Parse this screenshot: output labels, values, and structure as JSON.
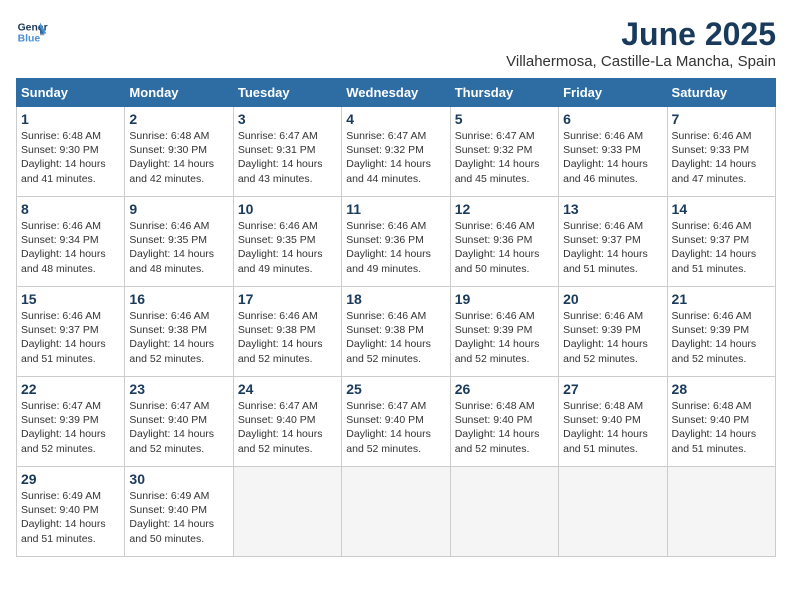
{
  "logo": {
    "line1": "General",
    "line2": "Blue"
  },
  "title": "June 2025",
  "subtitle": "Villahermosa, Castille-La Mancha, Spain",
  "days_of_week": [
    "Sunday",
    "Monday",
    "Tuesday",
    "Wednesday",
    "Thursday",
    "Friday",
    "Saturday"
  ],
  "weeks": [
    [
      {
        "day": "1",
        "sunrise": "Sunrise: 6:48 AM",
        "sunset": "Sunset: 9:30 PM",
        "daylight": "Daylight: 14 hours and 41 minutes."
      },
      {
        "day": "2",
        "sunrise": "Sunrise: 6:48 AM",
        "sunset": "Sunset: 9:30 PM",
        "daylight": "Daylight: 14 hours and 42 minutes."
      },
      {
        "day": "3",
        "sunrise": "Sunrise: 6:47 AM",
        "sunset": "Sunset: 9:31 PM",
        "daylight": "Daylight: 14 hours and 43 minutes."
      },
      {
        "day": "4",
        "sunrise": "Sunrise: 6:47 AM",
        "sunset": "Sunset: 9:32 PM",
        "daylight": "Daylight: 14 hours and 44 minutes."
      },
      {
        "day": "5",
        "sunrise": "Sunrise: 6:47 AM",
        "sunset": "Sunset: 9:32 PM",
        "daylight": "Daylight: 14 hours and 45 minutes."
      },
      {
        "day": "6",
        "sunrise": "Sunrise: 6:46 AM",
        "sunset": "Sunset: 9:33 PM",
        "daylight": "Daylight: 14 hours and 46 minutes."
      },
      {
        "day": "7",
        "sunrise": "Sunrise: 6:46 AM",
        "sunset": "Sunset: 9:33 PM",
        "daylight": "Daylight: 14 hours and 47 minutes."
      }
    ],
    [
      {
        "day": "8",
        "sunrise": "Sunrise: 6:46 AM",
        "sunset": "Sunset: 9:34 PM",
        "daylight": "Daylight: 14 hours and 48 minutes."
      },
      {
        "day": "9",
        "sunrise": "Sunrise: 6:46 AM",
        "sunset": "Sunset: 9:35 PM",
        "daylight": "Daylight: 14 hours and 48 minutes."
      },
      {
        "day": "10",
        "sunrise": "Sunrise: 6:46 AM",
        "sunset": "Sunset: 9:35 PM",
        "daylight": "Daylight: 14 hours and 49 minutes."
      },
      {
        "day": "11",
        "sunrise": "Sunrise: 6:46 AM",
        "sunset": "Sunset: 9:36 PM",
        "daylight": "Daylight: 14 hours and 49 minutes."
      },
      {
        "day": "12",
        "sunrise": "Sunrise: 6:46 AM",
        "sunset": "Sunset: 9:36 PM",
        "daylight": "Daylight: 14 hours and 50 minutes."
      },
      {
        "day": "13",
        "sunrise": "Sunrise: 6:46 AM",
        "sunset": "Sunset: 9:37 PM",
        "daylight": "Daylight: 14 hours and 51 minutes."
      },
      {
        "day": "14",
        "sunrise": "Sunrise: 6:46 AM",
        "sunset": "Sunset: 9:37 PM",
        "daylight": "Daylight: 14 hours and 51 minutes."
      }
    ],
    [
      {
        "day": "15",
        "sunrise": "Sunrise: 6:46 AM",
        "sunset": "Sunset: 9:37 PM",
        "daylight": "Daylight: 14 hours and 51 minutes."
      },
      {
        "day": "16",
        "sunrise": "Sunrise: 6:46 AM",
        "sunset": "Sunset: 9:38 PM",
        "daylight": "Daylight: 14 hours and 52 minutes."
      },
      {
        "day": "17",
        "sunrise": "Sunrise: 6:46 AM",
        "sunset": "Sunset: 9:38 PM",
        "daylight": "Daylight: 14 hours and 52 minutes."
      },
      {
        "day": "18",
        "sunrise": "Sunrise: 6:46 AM",
        "sunset": "Sunset: 9:38 PM",
        "daylight": "Daylight: 14 hours and 52 minutes."
      },
      {
        "day": "19",
        "sunrise": "Sunrise: 6:46 AM",
        "sunset": "Sunset: 9:39 PM",
        "daylight": "Daylight: 14 hours and 52 minutes."
      },
      {
        "day": "20",
        "sunrise": "Sunrise: 6:46 AM",
        "sunset": "Sunset: 9:39 PM",
        "daylight": "Daylight: 14 hours and 52 minutes."
      },
      {
        "day": "21",
        "sunrise": "Sunrise: 6:46 AM",
        "sunset": "Sunset: 9:39 PM",
        "daylight": "Daylight: 14 hours and 52 minutes."
      }
    ],
    [
      {
        "day": "22",
        "sunrise": "Sunrise: 6:47 AM",
        "sunset": "Sunset: 9:39 PM",
        "daylight": "Daylight: 14 hours and 52 minutes."
      },
      {
        "day": "23",
        "sunrise": "Sunrise: 6:47 AM",
        "sunset": "Sunset: 9:40 PM",
        "daylight": "Daylight: 14 hours and 52 minutes."
      },
      {
        "day": "24",
        "sunrise": "Sunrise: 6:47 AM",
        "sunset": "Sunset: 9:40 PM",
        "daylight": "Daylight: 14 hours and 52 minutes."
      },
      {
        "day": "25",
        "sunrise": "Sunrise: 6:47 AM",
        "sunset": "Sunset: 9:40 PM",
        "daylight": "Daylight: 14 hours and 52 minutes."
      },
      {
        "day": "26",
        "sunrise": "Sunrise: 6:48 AM",
        "sunset": "Sunset: 9:40 PM",
        "daylight": "Daylight: 14 hours and 52 minutes."
      },
      {
        "day": "27",
        "sunrise": "Sunrise: 6:48 AM",
        "sunset": "Sunset: 9:40 PM",
        "daylight": "Daylight: 14 hours and 51 minutes."
      },
      {
        "day": "28",
        "sunrise": "Sunrise: 6:48 AM",
        "sunset": "Sunset: 9:40 PM",
        "daylight": "Daylight: 14 hours and 51 minutes."
      }
    ],
    [
      {
        "day": "29",
        "sunrise": "Sunrise: 6:49 AM",
        "sunset": "Sunset: 9:40 PM",
        "daylight": "Daylight: 14 hours and 51 minutes."
      },
      {
        "day": "30",
        "sunrise": "Sunrise: 6:49 AM",
        "sunset": "Sunset: 9:40 PM",
        "daylight": "Daylight: 14 hours and 50 minutes."
      },
      null,
      null,
      null,
      null,
      null
    ]
  ]
}
